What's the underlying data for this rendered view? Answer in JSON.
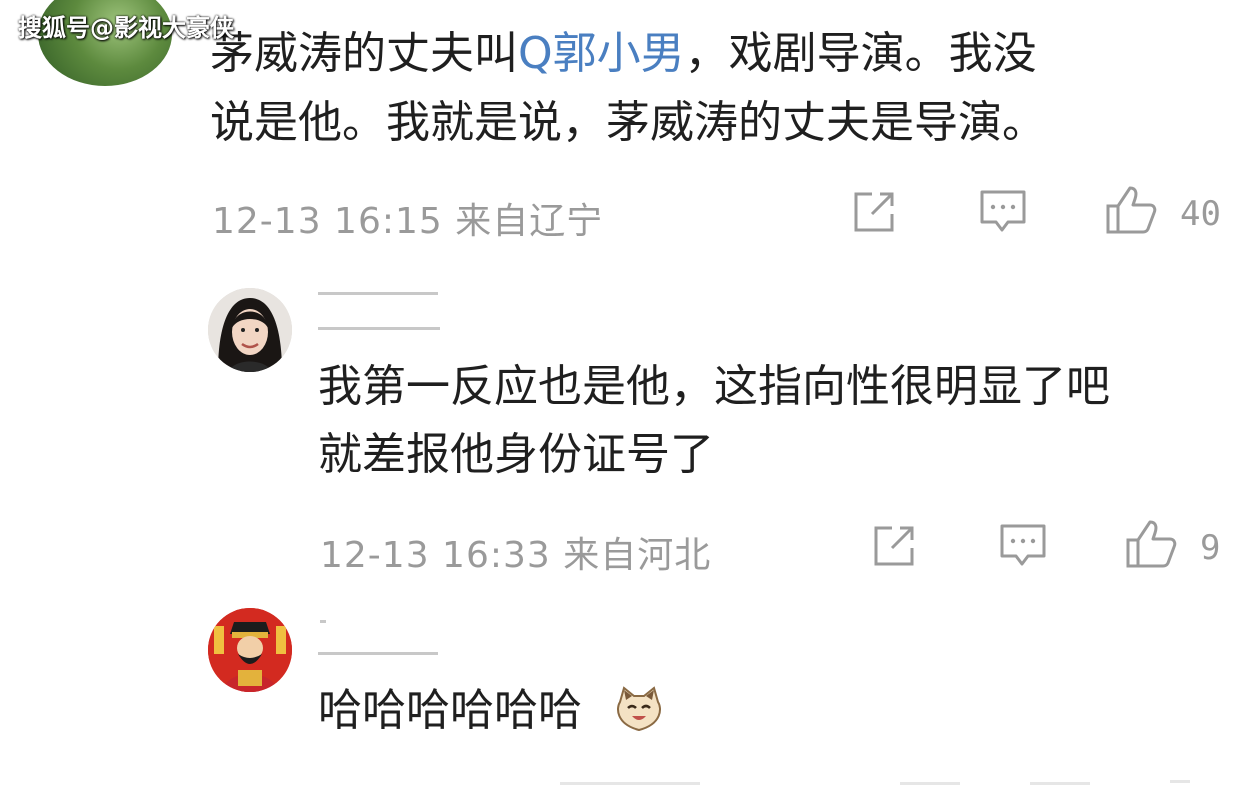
{
  "watermark": "搜狐号@影视大豪侠",
  "comments": [
    {
      "line1_a": "茅威涛的丈夫叫",
      "mention": "Q郭小男",
      "line1_b": "，戏剧导演。我没",
      "line2": "说是他。我就是说，茅威涛的丈夫是导演。",
      "meta": "12-13 16:15 来自辽宁",
      "likes": "40"
    },
    {
      "line1": "我第一反应也是他，这指向性很明显了吧",
      "line2": "就差报他身份证号了",
      "meta": "12-13 16:33 来自河北",
      "likes": "9"
    },
    {
      "line1": "哈哈哈哈哈哈"
    }
  ],
  "icons": {
    "share": "share-icon",
    "comment": "comment-icon",
    "like": "thumbs-up-icon",
    "emoji": "cat-face-emoji"
  },
  "colors": {
    "text": "#1f1f1f",
    "meta": "#9a9a9a",
    "link": "#4a7fc1"
  }
}
